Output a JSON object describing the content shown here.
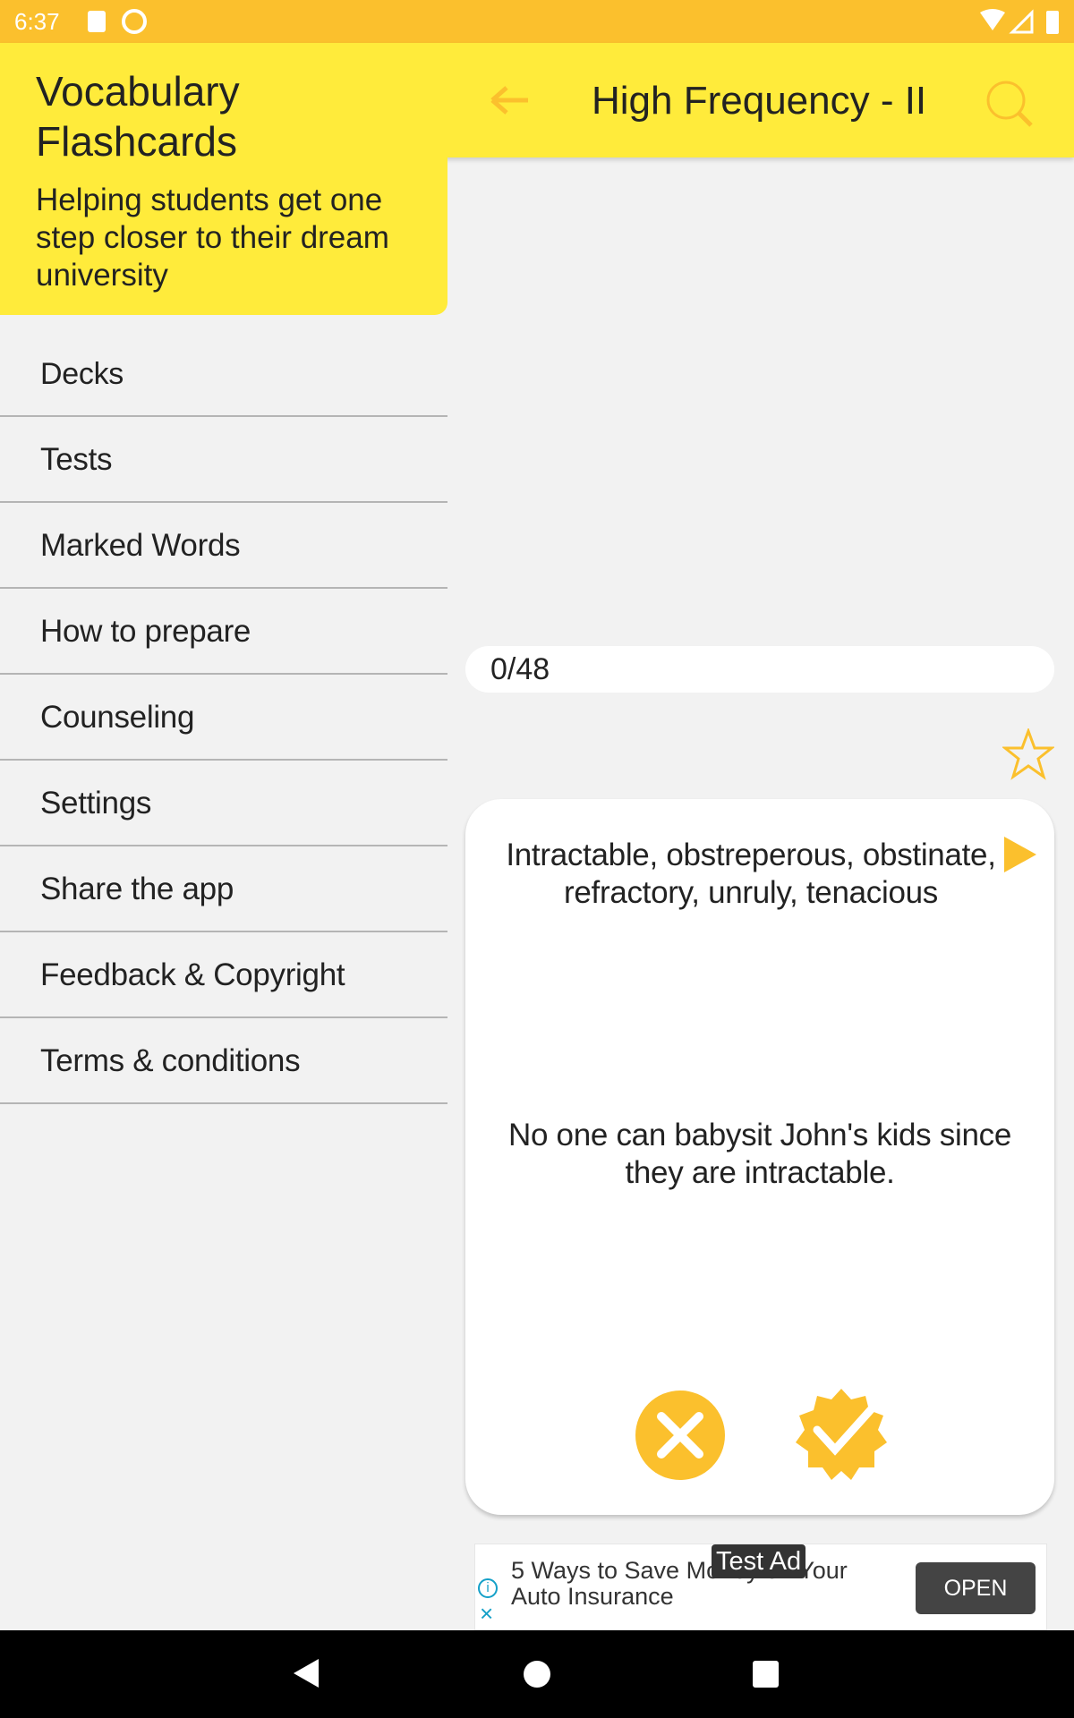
{
  "status_bar": {
    "time": "6:37"
  },
  "app_bar": {
    "title": "High Frequency - II",
    "back_icon": "arrow-left-icon",
    "search_icon": "search-icon"
  },
  "drawer": {
    "title": "Vocabulary Flashcards",
    "subtitle": "Helping students get one step closer to their dream university",
    "items": [
      {
        "label": "Decks"
      },
      {
        "label": "Tests"
      },
      {
        "label": "Marked Words"
      },
      {
        "label": "How to prepare"
      },
      {
        "label": "Counseling"
      },
      {
        "label": "Settings"
      },
      {
        "label": "Share the app"
      },
      {
        "label": "Feedback & Copyright"
      },
      {
        "label": "Terms & conditions"
      }
    ]
  },
  "progress": {
    "label": "0/48",
    "current": 0,
    "total": 48
  },
  "card": {
    "words": "Intractable, obstreperous, obstinate, refractory, unruly, tenacious",
    "example": "No one can babysit John's kids since they are intractable.",
    "marked": false
  },
  "ad": {
    "badge": "Test Ad",
    "text": "5 Ways to Save Money on Your Auto Insurance",
    "button": "OPEN"
  },
  "colors": {
    "accent": "#fbc02d",
    "header": "#ffeb3b",
    "status": "#fbc02d"
  }
}
